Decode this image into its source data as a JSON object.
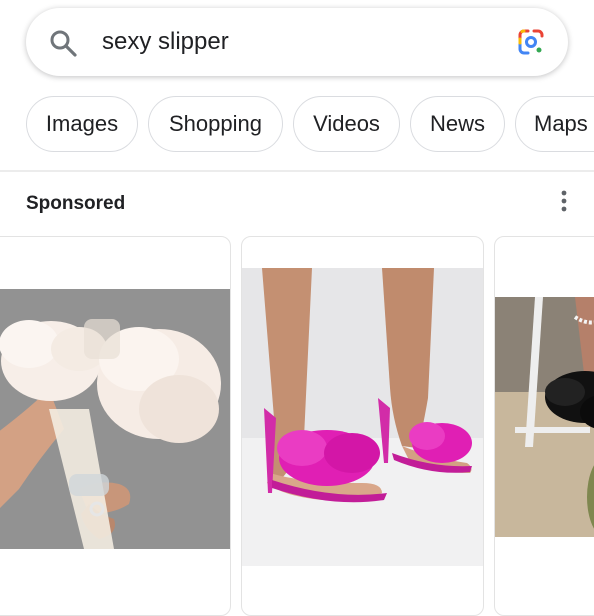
{
  "search": {
    "query": "sexy slipper",
    "search_icon": "search-icon",
    "lens_icon": "google-lens-icon"
  },
  "tabs": [
    {
      "label": "Images"
    },
    {
      "label": "Shopping"
    },
    {
      "label": "Videos"
    },
    {
      "label": "News"
    },
    {
      "label": "Maps"
    }
  ],
  "sponsored": {
    "label": "Sponsored",
    "more_icon": "more-vertical-icon"
  },
  "products": [
    {
      "image": "white-feather-heeled-slipper"
    },
    {
      "image": "pink-feather-stiletto-mule"
    },
    {
      "image": "black-feather-slipper"
    }
  ],
  "colors": {
    "accent_lens_blue": "#4285f4",
    "accent_lens_red": "#ea4335",
    "accent_lens_yellow": "#fbbc04",
    "accent_lens_green": "#34a853",
    "pink_feather": "#e01fb4"
  }
}
